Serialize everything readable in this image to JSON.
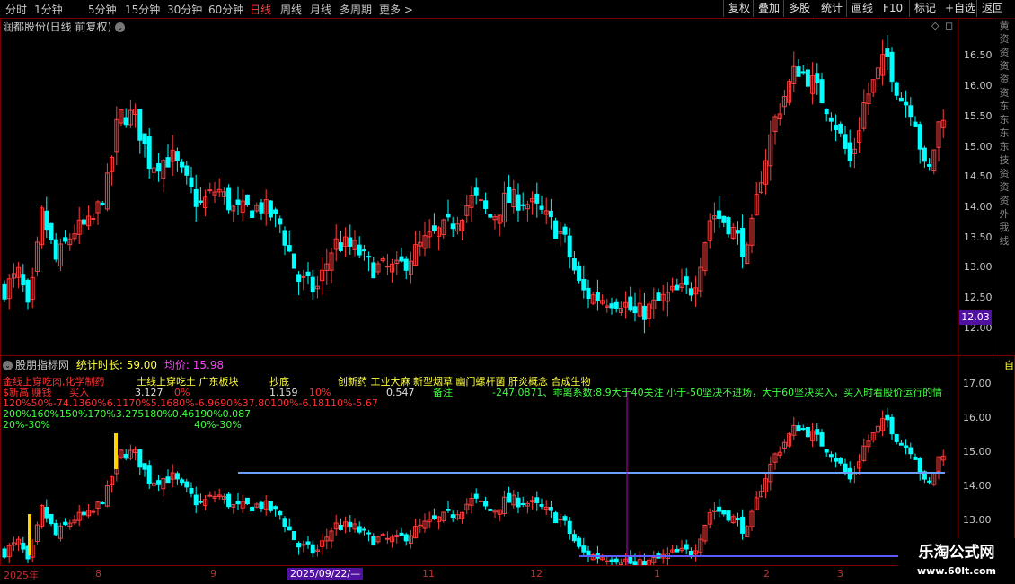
{
  "toolbar": {
    "periods": [
      "分时",
      "1分钟",
      "5分钟",
      "15分钟",
      "30分钟",
      "60分钟",
      "日线",
      "周线",
      "月线",
      "多周期",
      "更多 >"
    ],
    "active_period": "日线",
    "right_buttons": [
      "复权",
      "叠加",
      "多股",
      "统计",
      "画线",
      "F10",
      "标记",
      "+自选",
      "返回"
    ]
  },
  "main_chart": {
    "title": "润都股份(日线 前复权)",
    "price_labels": [
      "16.50",
      "16.00",
      "15.50",
      "15.00",
      "14.50",
      "14.00",
      "13.50",
      "13.00",
      "12.50",
      "12.00"
    ],
    "current_price_tag": "12.03",
    "side_strip_text": "黄资资资资资东东东东技资资资外我线"
  },
  "indicator": {
    "name": "股朋指标网",
    "stat_label": "统计时长: 59.00",
    "avg_label": "均价: 15.98",
    "price_labels": [
      "17.00",
      "16.00",
      "15.00",
      "14.00",
      "13.00"
    ],
    "side_mark": "自",
    "row1": [
      {
        "text": "金线上穿吃肉,化学制药",
        "color": "#ff3030"
      },
      {
        "text": "土线上穿吃土 广东板块",
        "color": "#ffff40"
      },
      {
        "text": "抄底",
        "color": "#ffff40"
      },
      {
        "text": "创新药 工业大麻 新型烟草 幽门螺杆菌 肝炎概念 合成生物",
        "color": "#ffff40"
      }
    ],
    "row2": [
      {
        "text": "$新高 赚钱",
        "color": "#ff3030"
      },
      {
        "text": "买入",
        "color": "#ff3030"
      },
      {
        "text": "3.127",
        "color": "#e0e0e0"
      },
      {
        "text": "0%",
        "color": "#ff3030"
      },
      {
        "text": "1.159",
        "color": "#e0e0e0"
      },
      {
        "text": "10%",
        "color": "#ff3030"
      },
      {
        "text": "0.547",
        "color": "#e0e0e0"
      },
      {
        "text": "备注",
        "color": "#40ff40"
      },
      {
        "text": "-247.0871、乖离系数:8.9大于40关注 小于-50坚决不进场，大于60坚决买入，买入时看股价运行的情",
        "color": "#40ff40"
      }
    ],
    "row3": {
      "text": "120%50%-74.1360%6.1170%5.1680%-6.9690%37.80100%-6.18110%-5.67",
      "color": "#ff3030"
    },
    "row4": {
      "text": "200%160%150%170%3.275180%0.46190%0.087",
      "color": "#40ff40"
    },
    "row5": [
      {
        "text": "20%-30%",
        "color": "#40ff40"
      },
      {
        "text": "40%-30%",
        "color": "#40ff40"
      }
    ]
  },
  "date_axis": {
    "labels": [
      "2025年",
      "8",
      "9",
      "2025/09/22/—",
      "11",
      "12",
      "1",
      "2",
      "3"
    ],
    "highlighted": "2025/09/22/—"
  },
  "watermark": {
    "title": "乐淘公式网",
    "url": "www.60lt.com"
  },
  "colors": {
    "up": "#ff3c3c",
    "down": "#00ffff",
    "frame": "#7a0000",
    "cursor": "#c000c0",
    "support_line": "#6aa0ff",
    "bottom_line": "#5a5aff",
    "signal_bar": "#ffd400"
  }
}
